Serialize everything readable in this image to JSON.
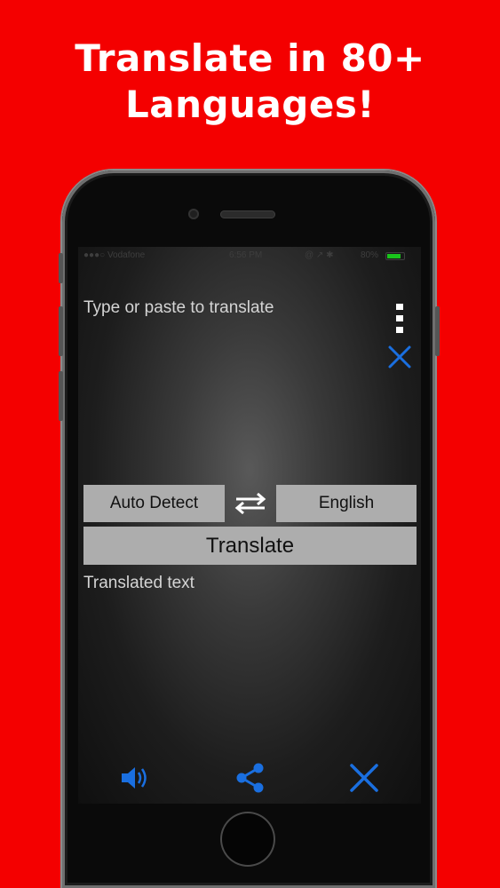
{
  "headline": {
    "line1": "Translate in 80+",
    "line2": "Languages!"
  },
  "status_bar": {
    "carrier": "●●●○ Vodafone",
    "time": "6:56 PM",
    "icons": "@ ↗ ✱",
    "battery": "80%",
    "battery_level": 0.8,
    "battery_color": "#19c41b"
  },
  "input": {
    "placeholder": "Type or paste to translate"
  },
  "language_bar": {
    "source": "Auto Detect",
    "target": "English"
  },
  "translate_button": {
    "label": "Translate"
  },
  "output": {
    "placeholder": "Translated text"
  },
  "icons": {
    "menu": "more-vertical-icon",
    "clear_input": "close-icon",
    "swap": "swap-arrows-icon",
    "speaker": "speaker-icon",
    "share": "share-icon",
    "clear_output": "close-icon"
  },
  "colors": {
    "background": "#f40000",
    "accent": "#1a6fe0",
    "button": "#adadad"
  }
}
